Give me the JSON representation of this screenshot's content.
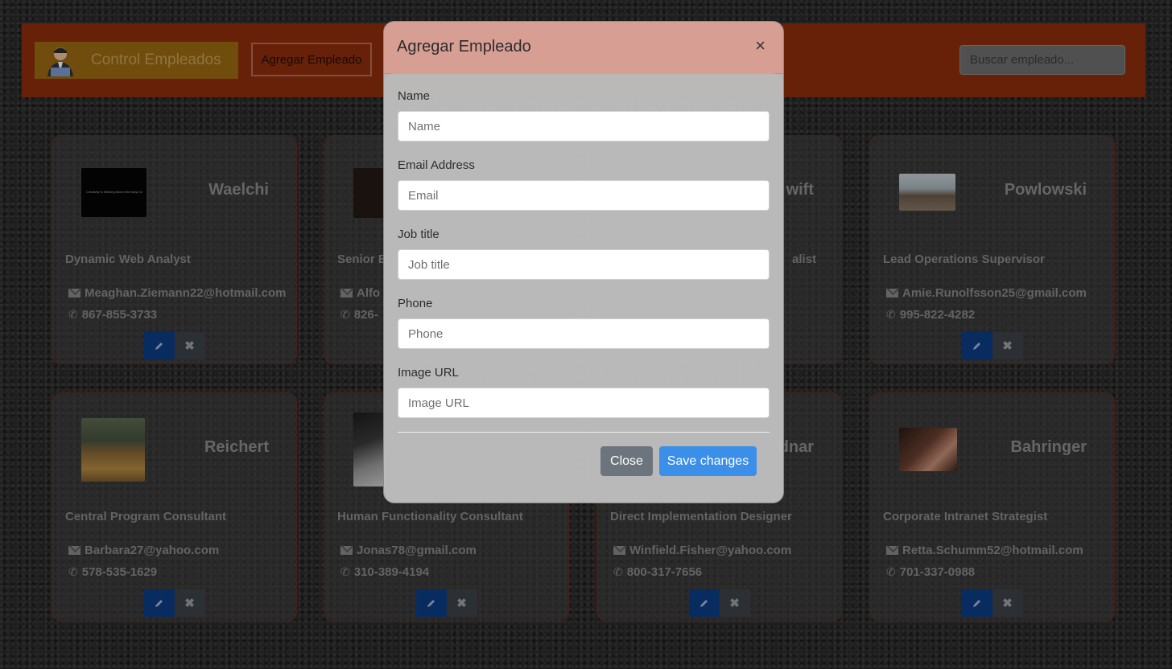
{
  "navbar": {
    "brand_name": "Control Empleados",
    "add_employee_label": "Agregar Empleado",
    "search_placeholder": "Buscar empleado..."
  },
  "cards": [
    {
      "surname": "Waelchi",
      "job": "Dynamic Web Analyst",
      "email": "Meaghan.Ziemann22@hotmail.com",
      "phone": "867-855-3733",
      "thumb_caption": "Creativity is thinking about new ways to do it."
    },
    {
      "surname": "",
      "job": "Senior E",
      "email": "Alfo",
      "phone": "826-",
      "thumb_caption": ""
    },
    {
      "surname": "wift",
      "job": "alist",
      "email": "",
      "phone": "",
      "thumb_caption": ""
    },
    {
      "surname": "Powlowski",
      "job": "Lead Operations Supervisor",
      "email": "Amie.Runolfsson25@gmail.com",
      "phone": "995-822-4282",
      "thumb_caption": ""
    },
    {
      "surname": "Reichert",
      "job": "Central Program Consultant",
      "email": "Barbara27@yahoo.com",
      "phone": "578-535-1629",
      "thumb_caption": ""
    },
    {
      "surname": "",
      "job": "Human Functionality Consultant",
      "email": "Jonas78@gmail.com",
      "phone": "310-389-4194",
      "thumb_caption": ""
    },
    {
      "surname": "dnar",
      "job": "Direct Implementation Designer",
      "email": "Winfield.Fisher@yahoo.com",
      "phone": "800-317-7656",
      "thumb_caption": ""
    },
    {
      "surname": "Bahringer",
      "job": "Corporate Intranet Strategist",
      "email": "Retta.Schumm52@hotmail.com",
      "phone": "701-337-0988",
      "thumb_caption": ""
    }
  ],
  "card_actions": {
    "delete_symbol": "✖",
    "phone_symbol": "✆"
  },
  "modal": {
    "title": "Agregar Empleado",
    "close_symbol": "×",
    "fields": [
      {
        "label": "Name",
        "placeholder": "Name",
        "value": ""
      },
      {
        "label": "Email Address",
        "placeholder": "Email",
        "value": ""
      },
      {
        "label": "Job title",
        "placeholder": "Job title",
        "value": ""
      },
      {
        "label": "Phone",
        "placeholder": "Phone",
        "value": ""
      },
      {
        "label": "Image URL",
        "placeholder": "Image URL",
        "value": ""
      }
    ],
    "close_label": "Close",
    "save_label": "Save changes"
  },
  "colors": {
    "navbar": "#8f2f0c",
    "brand_bg": "#9c6a12",
    "edit_button": "#0d3d86",
    "modal_header": "#d79e94",
    "save_button": "#3b8fe8",
    "close_button": "#6c757d"
  }
}
